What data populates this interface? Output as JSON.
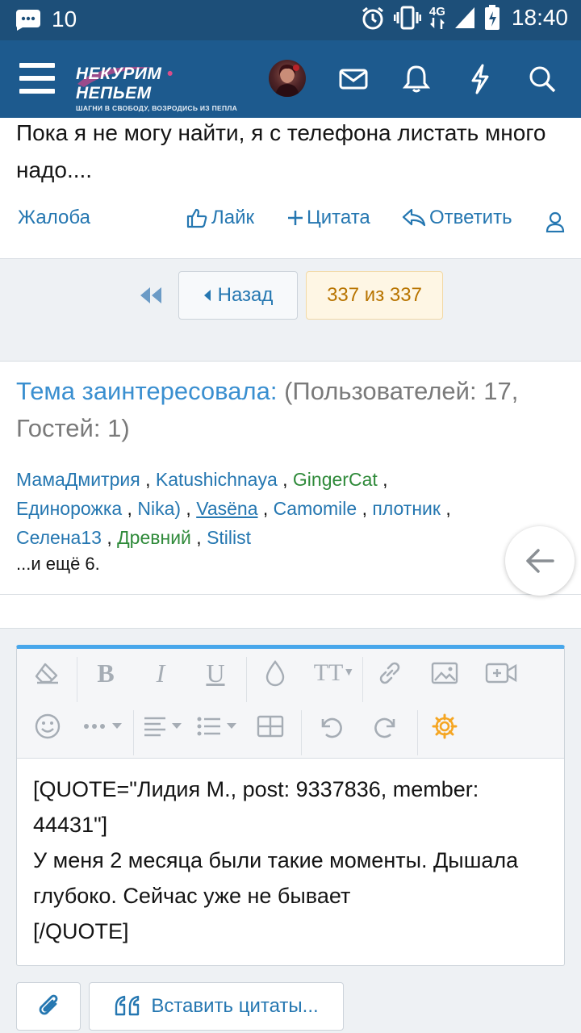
{
  "status_bar": {
    "notification_count": "10",
    "network": "4G",
    "time": "18:40"
  },
  "header": {
    "logo_title_left": "НЕКУРИМ",
    "logo_title_right": "НЕПЬЕМ",
    "logo_subtitle": "ШАГНИ В СВОБОДУ, ВОЗРОДИСЬ ИЗ ПЕПЛА",
    "icons": [
      "menu-icon",
      "avatar",
      "envelope-icon",
      "bell-icon",
      "bolt-icon",
      "search-icon"
    ]
  },
  "post": {
    "text": "Пока я не могу найти, я с телефона листать много надо....",
    "actions": {
      "report": "Жалоба",
      "like": "Лайк",
      "quote": "Цитата",
      "reply": "Ответить"
    }
  },
  "pagination": {
    "back": "Назад",
    "current": "337 из 337"
  },
  "interested": {
    "label": "Тема заинтересовала:",
    "counts": "(Пользователей: 17, Гостей: 1)",
    "users": [
      {
        "name": "МамаДмитрия",
        "color": "#2577b1"
      },
      {
        "name": "Katushichnaya",
        "color": "#2577b1"
      },
      {
        "name": "GingerCat",
        "color": "#2f8a3a"
      },
      {
        "name": "Единорожка",
        "color": "#2577b1"
      },
      {
        "name": "Nika)",
        "color": "#2577b1"
      },
      {
        "name": "Vasëna",
        "color": "#2577b1"
      },
      {
        "name": "Camomile",
        "color": "#2577b1"
      },
      {
        "name": "плотник",
        "color": "#2577b1"
      },
      {
        "name": "Селена13",
        "color": "#2577b1"
      },
      {
        "name": "Древний",
        "color": "#2f8a3a"
      },
      {
        "name": "Stilist",
        "color": "#2577b1"
      }
    ],
    "more": "...и ещё 6."
  },
  "editor": {
    "content": "[QUOTE=\"Лидия М., post: 9337836, member: 44431\"]\nУ меня 2 месяца были такие моменты. Дышала глубоко. Сейчас уже не бывает\n[/QUOTE]",
    "toolbar_labels": {
      "bold": "B",
      "italic": "I",
      "underline": "U",
      "font_size": "TT"
    }
  },
  "bottom": {
    "insert_quotes": "Вставить цитаты..."
  },
  "colors": {
    "status_bar": "#1d4f79",
    "header": "#1d5a8e",
    "link": "#2577b1",
    "accent_orange": "#b87400",
    "editor_border": "#47a7eb"
  }
}
